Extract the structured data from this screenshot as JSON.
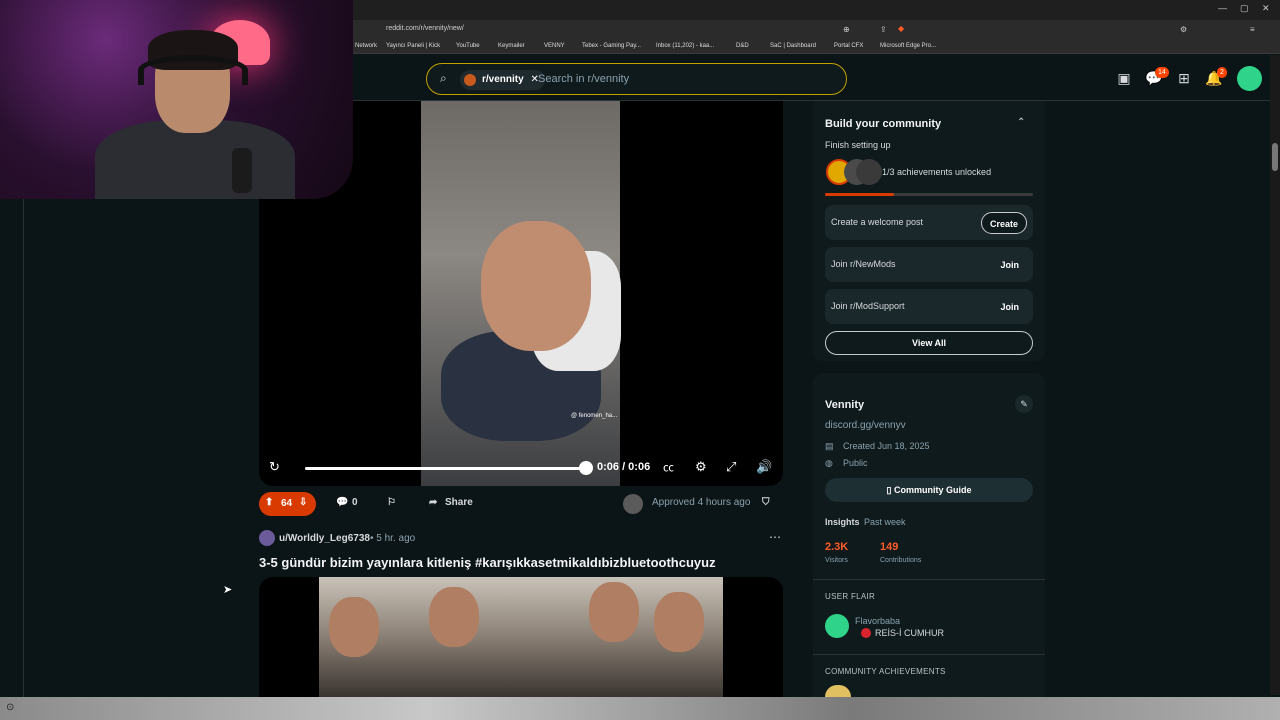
{
  "browser": {
    "url": "reddit.com/r/vennity/new/",
    "bookmarks": [
      "Network",
      "Yayıncı Paneli | Kick",
      "YouTube",
      "Keymailer",
      "VENNY",
      "Tebex - Gaming Pay...",
      "Inbox (11,202) - kaa...",
      "D&D",
      "SaC | Dashboard",
      "Portal CFX",
      "Microsoft Edge Pro..."
    ]
  },
  "header": {
    "community_pill": "r/vennity",
    "search_placeholder": "Search in r/vennity",
    "chat_badge": "14",
    "notif_badge": "2"
  },
  "video1": {
    "time": "0:06 / 0:06",
    "progress": 1.0,
    "watermark": "@ fenomen_ha..."
  },
  "post1_actions": {
    "votes": "64",
    "comments": "0",
    "share": "Share",
    "approved": "Approved 4 hours ago"
  },
  "post2": {
    "user": "u/Worldly_Leg6738",
    "time": "• 5 hr. ago",
    "title": "3-5 gündür bizim yayınlara kitleniş #karışıkkasetmikaldıbizbluetoothcuyuz"
  },
  "build_card": {
    "title": "Build your community",
    "subtitle": "Finish setting up",
    "achievements": "1/3 achievements unlocked",
    "progress": 0.33,
    "rows": [
      {
        "label": "Create a welcome post",
        "button": "Create"
      },
      {
        "label": "Join r/NewMods",
        "button": "Join"
      },
      {
        "label": "Join r/ModSupport",
        "button": "Join"
      }
    ],
    "view_all": "View All"
  },
  "about_card": {
    "name": "Vennity",
    "link": "discord.gg/vennyv",
    "created": "Created Jun 18, 2025",
    "visibility": "Public",
    "guide": "Community Guide",
    "insights": "Insights",
    "insights_range": "Past week",
    "visitors_value": "2.3K",
    "visitors_label": "Visitors",
    "contrib_value": "149",
    "contrib_label": "Contributions",
    "user_flair_heading": "USER FLAIR",
    "flair_user": "Flavorbaba",
    "flair_text": "REİS-İ CUMHUR",
    "achievements_heading": "COMMUNITY ACHIEVEMENTS"
  },
  "colors": {
    "accent": "#d93a00",
    "search_border": "#c2a000",
    "background": "#0b1416"
  }
}
